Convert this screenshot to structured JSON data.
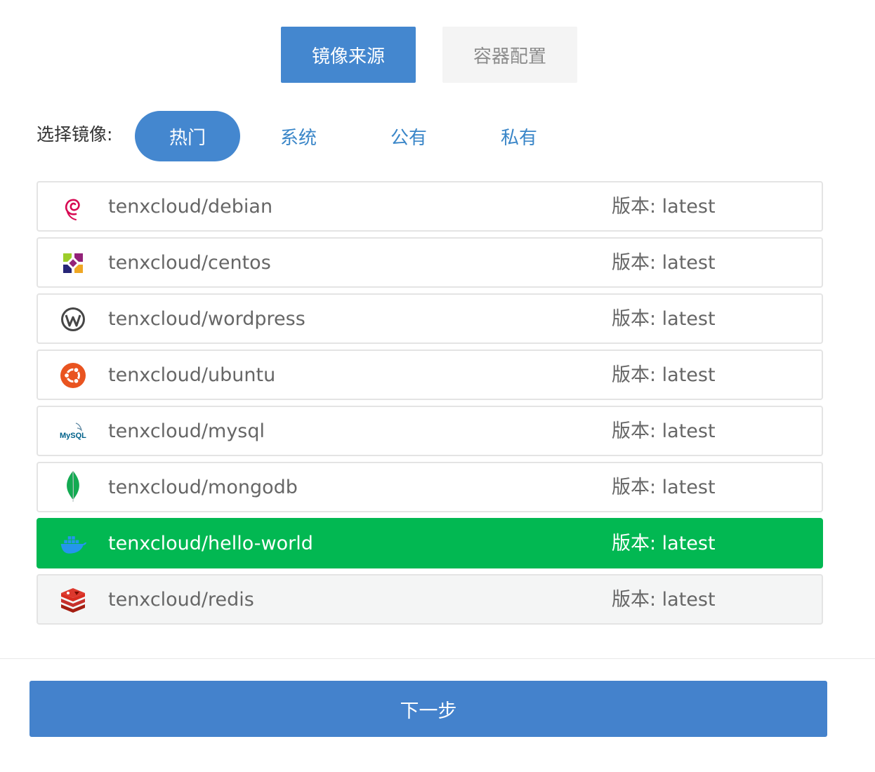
{
  "steps": [
    {
      "label": "镜像来源",
      "active": true
    },
    {
      "label": "容器配置",
      "active": false
    }
  ],
  "filter": {
    "label": "选择镜像:",
    "tabs": [
      {
        "label": "热门",
        "active": true
      },
      {
        "label": "系统",
        "active": false
      },
      {
        "label": "公有",
        "active": false
      },
      {
        "label": "私有",
        "active": false
      }
    ]
  },
  "images": [
    {
      "name": "tenxcloud/debian",
      "version": "版本: latest",
      "icon": "debian-icon"
    },
    {
      "name": "tenxcloud/centos",
      "version": "版本: latest",
      "icon": "centos-icon"
    },
    {
      "name": "tenxcloud/wordpress",
      "version": "版本: latest",
      "icon": "wordpress-icon"
    },
    {
      "name": "tenxcloud/ubuntu",
      "version": "版本: latest",
      "icon": "ubuntu-icon"
    },
    {
      "name": "tenxcloud/mysql",
      "version": "版本: latest",
      "icon": "mysql-icon",
      "icon_text": "MySQL"
    },
    {
      "name": "tenxcloud/mongodb",
      "version": "版本: latest",
      "icon": "mongodb-icon"
    },
    {
      "name": "tenxcloud/hello-world",
      "version": "版本: latest",
      "icon": "docker-icon",
      "selected": true
    },
    {
      "name": "tenxcloud/redis",
      "version": "版本: latest",
      "icon": "redis-icon",
      "hovered": true
    }
  ],
  "footer": {
    "next_label": "下一步"
  },
  "colors": {
    "primary": "#4487cf",
    "selected_row": "#02b852",
    "link": "#3a86c8",
    "row_border": "#e4e4e4"
  }
}
